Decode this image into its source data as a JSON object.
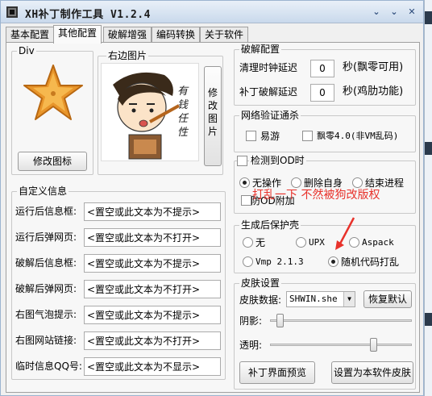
{
  "window": {
    "title": "XH补丁制作工具 V1.2.4"
  },
  "tabs": [
    "基本配置",
    "其他配置",
    "破解增强",
    "编码转换",
    "关于软件"
  ],
  "div_group": {
    "label": "Div",
    "icon_name": "star-icon",
    "change_icon_button": "修改图标"
  },
  "right_image": {
    "label": "右边图片",
    "image_name": "cartoon-girl-image",
    "image_text": "有钱任性",
    "change_button": "修改图片"
  },
  "crack_config": {
    "label": "破解配置",
    "cleanup_delay": {
      "label": "清理时钟延迟",
      "value": "0",
      "unit": "秒(飘零可用)"
    },
    "patch_delay": {
      "label": "补丁破解延迟",
      "value": "0",
      "unit": "秒(鸡肋功能)"
    }
  },
  "network": {
    "label": "网络验证通杀",
    "options": [
      "易游",
      "飘零4.0(非VM乱码)"
    ]
  },
  "od_detect": {
    "label": "检测到OD时",
    "options": [
      "无操作",
      "删除自身",
      "结束进程"
    ],
    "checkbox_label": "防OD附加",
    "annotation": "打乱一下 不然被狗改版权"
  },
  "custom_info": {
    "label": "自定义信息",
    "rows": [
      {
        "label": "运行后信息框:",
        "value": "<置空或此文本为不提示>"
      },
      {
        "label": "运行后弹网页:",
        "value": "<置空或此文本为不打开>"
      },
      {
        "label": "破解后信息框:",
        "value": "<置空或此文本为不提示>"
      },
      {
        "label": "破解后弹网页:",
        "value": "<置空或此文本为不打开>"
      },
      {
        "label": "右图气泡提示:",
        "value": "<置空或此文本为不提示>"
      },
      {
        "label": "右图网站链接:",
        "value": "<置空或此文本为不打开>"
      },
      {
        "label": "临时信息QQ号:",
        "value": "<置空或此文本为不显示>"
      }
    ]
  },
  "protect": {
    "label": "生成后保护壳",
    "options": [
      "无",
      "UPX",
      "Aspack",
      "Vmp 2.1.3",
      "随机代码打乱"
    ],
    "selected": "随机代码打乱"
  },
  "skin": {
    "label": "皮肤设置",
    "data_label": "皮肤数据:",
    "data_value": "SHWIN.she",
    "restore_button": "恢复默认",
    "shadow_label": "阴影:",
    "shadow_level": 0.0,
    "opacity_label": "透明:",
    "opacity_level": 0.62,
    "preview_button": "补丁界面预览",
    "set_skin_button": "设置为本软件皮肤"
  },
  "colors": {
    "annotation_red": "#e8322b",
    "title_bg": "#d3e1f1"
  }
}
